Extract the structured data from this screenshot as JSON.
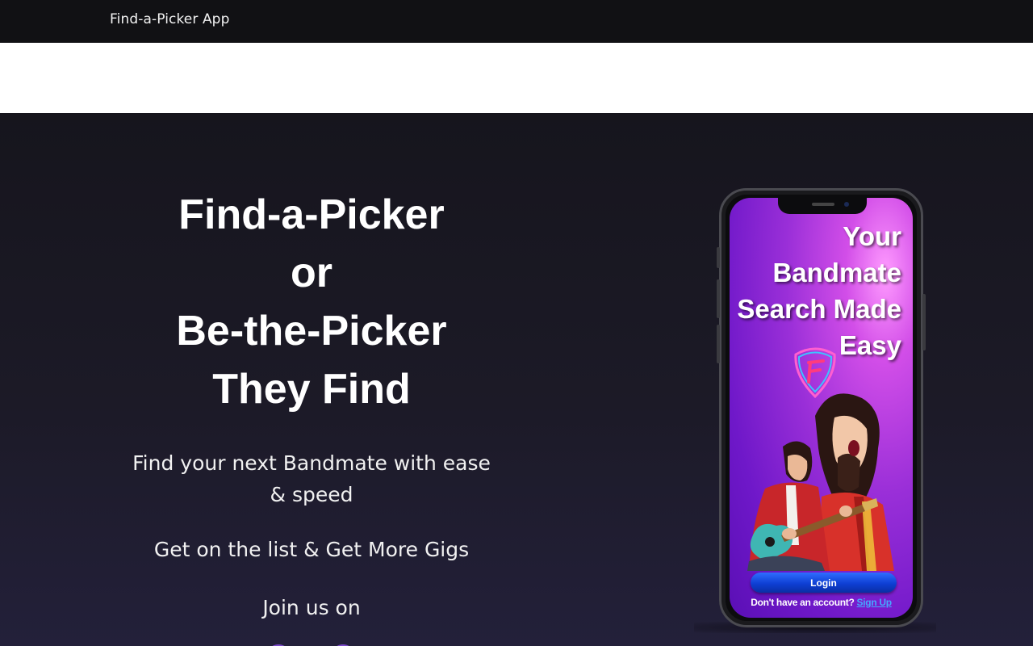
{
  "header": {
    "brand": "Find-a-Picker App"
  },
  "hero": {
    "headline": [
      "Find-a-Picker",
      "or",
      "Be-the-Picker",
      "They Find"
    ],
    "tagline": "Find your next Bandmate with ease & speed",
    "subline": "Get on the list & Get More Gigs",
    "join": "Join us on",
    "social_icons": [
      "social-icon-1",
      "social-icon-2"
    ]
  },
  "phone": {
    "screen_title": [
      "Your",
      "Bandmate",
      "Search Made",
      "Easy"
    ],
    "login_label": "Login",
    "signup_prompt": "Don't have an account?",
    "signup_link": "Sign Up"
  },
  "colors": {
    "topbar_bg": "#111114",
    "hero_bg": "#1c1a27",
    "accent_purple": "#7a48c9",
    "login_blue": "#0e3fd4",
    "link_blue": "#45a8ff"
  }
}
